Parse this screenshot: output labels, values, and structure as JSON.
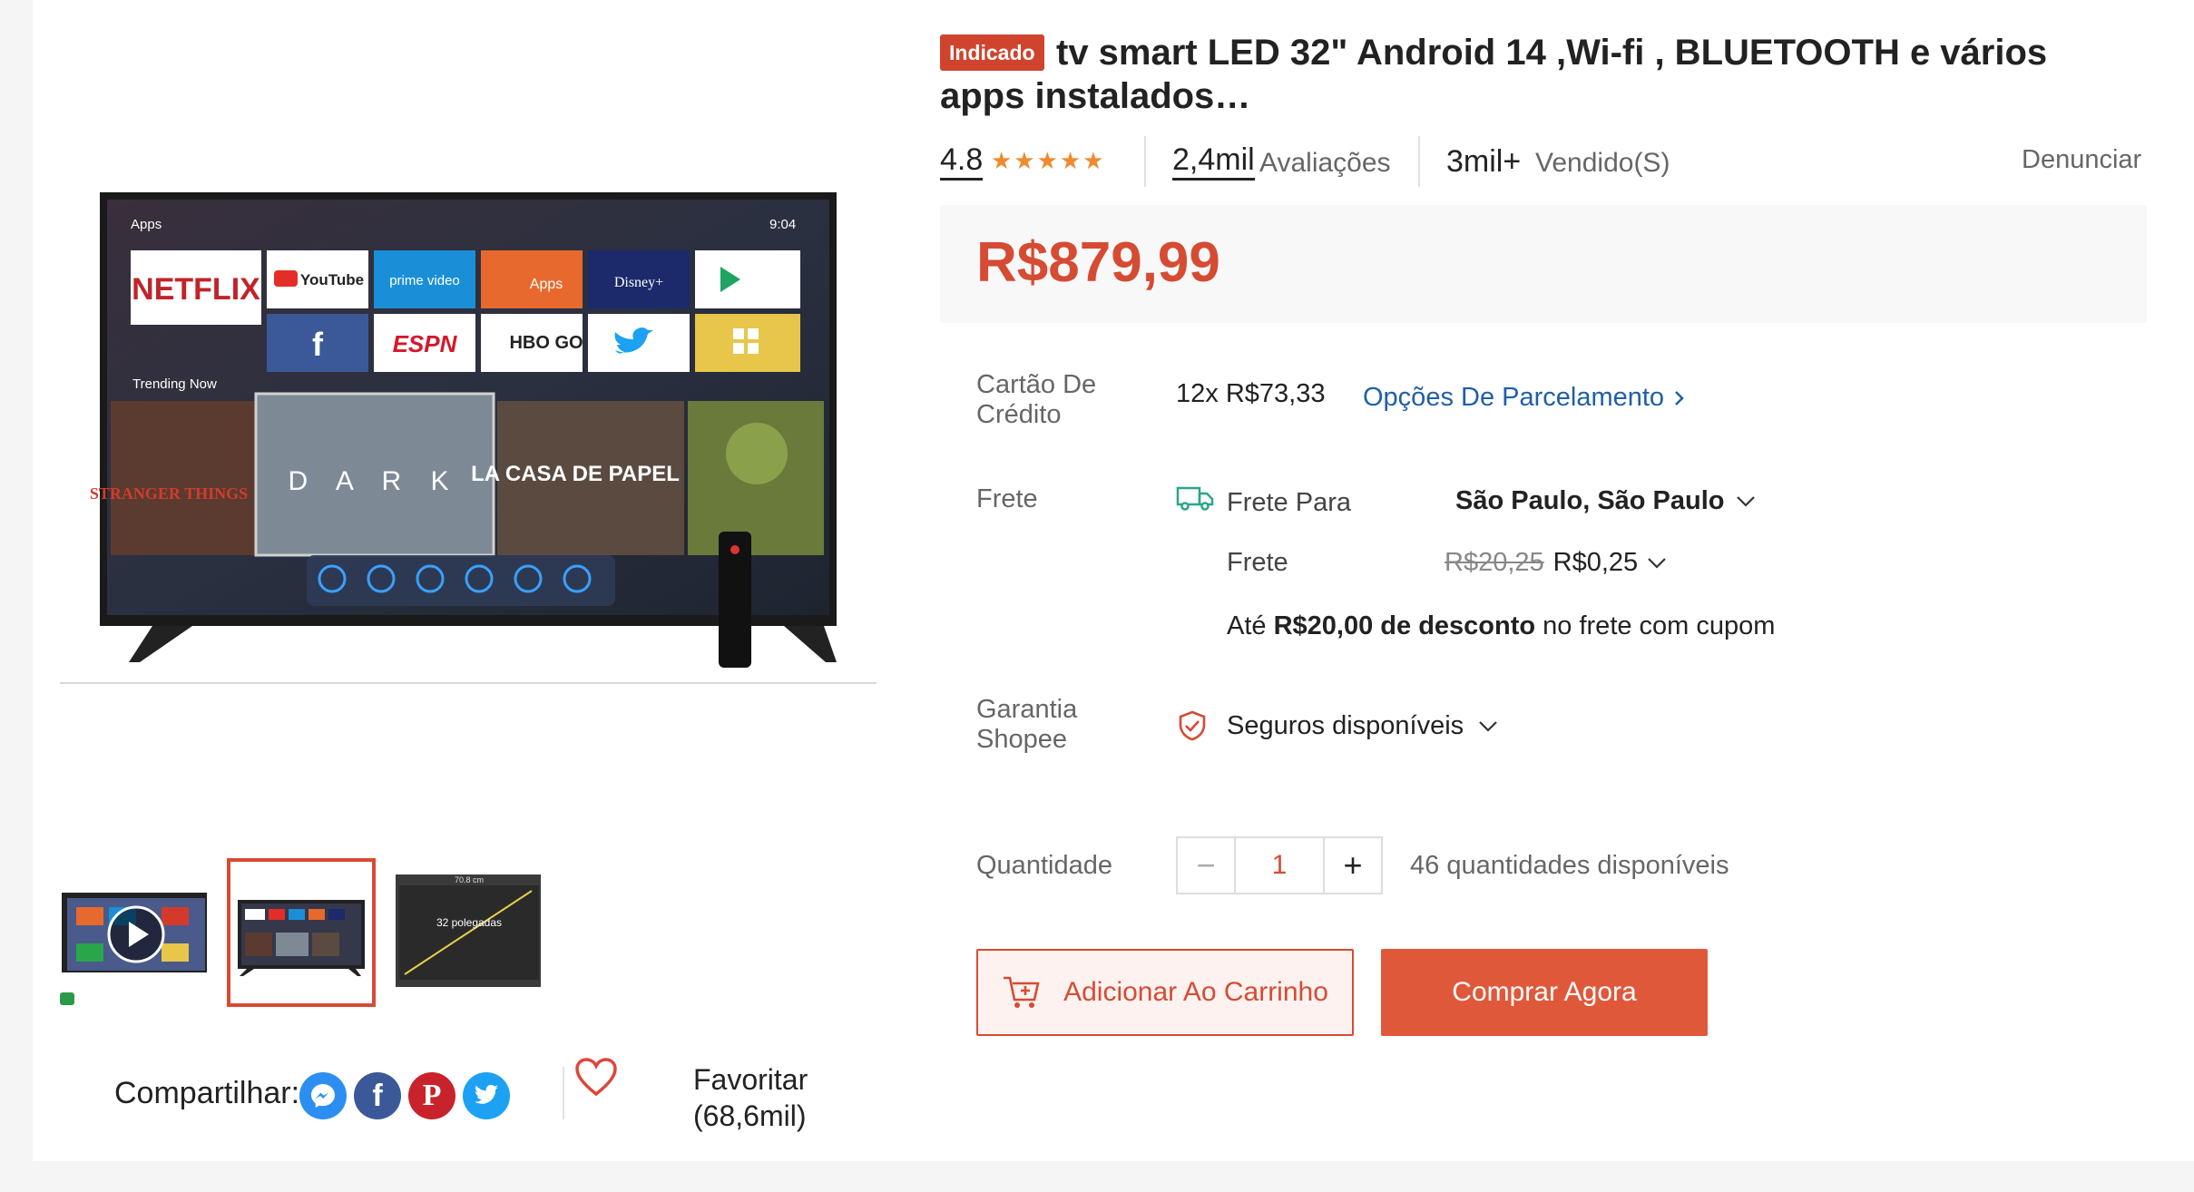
{
  "product": {
    "badge": "Indicado",
    "title": "tv smart LED 32\" Android 14 ,Wi-fi , BLUETOOTH e vários apps instalados…",
    "rating": "4.8",
    "stars": "★★★★★",
    "reviews_count": "2,4mil",
    "reviews_label": "Avaliações",
    "sold_count": "3mil+",
    "sold_label": "Vendido(S)",
    "report_label": "Denunciar",
    "price": "R$879,99"
  },
  "tv_screen": {
    "apps_label": "Apps",
    "clock": "9:04",
    "trending_label": "Trending Now",
    "tiles": [
      "NETFLIX",
      "YouTube",
      "prime video",
      "Apps",
      "Disney+",
      "",
      "f",
      "ESPN",
      "HBO GO",
      "",
      ""
    ],
    "shows": [
      "STRANGER THINGS",
      "D A R K",
      "LA CASA DE PAPEL",
      ""
    ],
    "thumb3_size": "70.8 cm",
    "thumb3_label": "32 polegadas"
  },
  "payment": {
    "label": "Cartão De Crédito",
    "installments": "12x R$73,33",
    "options_link": "Opções De Parcelamento"
  },
  "shipping": {
    "label": "Frete",
    "to_label": "Frete Para",
    "destination": "São Paulo, São Paulo",
    "cost_label": "Frete",
    "old_price": "R$20,25",
    "new_price": "R$0,25",
    "discount_prefix": "Até",
    "discount_bold": "R$20,00 de desconto",
    "discount_suffix": "no frete com cupom"
  },
  "warranty": {
    "label": "Garantia Shopee",
    "value": "Seguros disponíveis"
  },
  "quantity": {
    "label": "Quantidade",
    "value": "1",
    "minus": "−",
    "plus": "+",
    "available": "46 quantidades disponíveis"
  },
  "actions": {
    "add_to_cart": "Adicionar Ao Carrinho",
    "buy_now": "Comprar Agora"
  },
  "share": {
    "label": "Compartilhar:"
  },
  "favorite": {
    "label": "Favoritar",
    "count": "(68,6mil)"
  },
  "colors": {
    "accent": "#d64b33",
    "star": "#ee8a2f",
    "link": "#1f5fa8",
    "messenger": "#2c8ef0",
    "facebook": "#3b5998",
    "pinterest": "#c8232c",
    "twitter": "#1da1f2"
  },
  "icons": [
    "play-icon",
    "messenger-icon",
    "facebook-icon",
    "pinterest-icon",
    "twitter-icon",
    "heart-icon",
    "truck-icon",
    "chevron-right-icon",
    "chevron-down-icon",
    "shield-icon",
    "cart-plus-icon"
  ]
}
